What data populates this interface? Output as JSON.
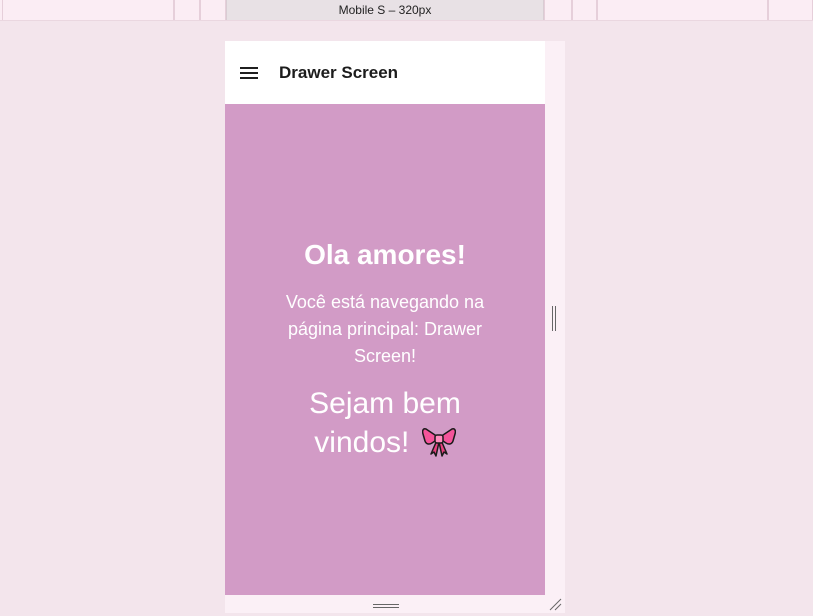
{
  "ruler": {
    "active_label": "Mobile S – 320px"
  },
  "app": {
    "header": {
      "title": "Drawer Screen",
      "menu_icon": "hamburger-menu-icon"
    },
    "content": {
      "headline": "Ola amores!",
      "subtitle": "Você está navegando na página principal: Drawer Screen!",
      "welcome": "Sejam bem vindos!",
      "welcome_icon": "ribbon-bow-icon"
    }
  },
  "colors": {
    "page_background": "#f3e5ec",
    "content_background": "#d29bc6",
    "header_background": "#ffffff",
    "text_light": "#ffffff",
    "text_dark": "#1c1c1c"
  }
}
